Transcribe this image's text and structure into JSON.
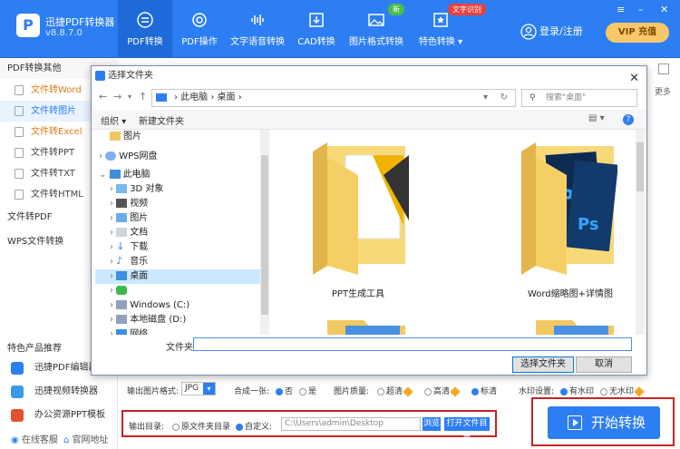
{
  "app": {
    "name": "迅捷PDF转换器",
    "version": "v8.8.7.0",
    "logo_letter": "P"
  },
  "nav": [
    {
      "label": "PDF转换",
      "icon": "pdf-convert-icon",
      "active": true
    },
    {
      "label": "PDF操作",
      "icon": "gear-icon"
    },
    {
      "label": "文字语音转换",
      "icon": "waveform-icon"
    },
    {
      "label": "CAD转换",
      "icon": "download-box-icon"
    },
    {
      "label": "图片格式转换",
      "icon": "image-icon",
      "badge": "新"
    },
    {
      "label": "特色转换",
      "icon": "star-box-icon",
      "badge": "文字识别"
    }
  ],
  "header": {
    "login": "登录/注册",
    "vip": "VIP 充值"
  },
  "sidebar": {
    "group_pdf": "PDF转换其他",
    "items": [
      {
        "label": "文件转Word"
      },
      {
        "label": "文件转图片"
      },
      {
        "label": "文件转Excel"
      },
      {
        "label": "文件转PPT"
      },
      {
        "label": "文件转TXT"
      },
      {
        "label": "文件转HTML"
      }
    ],
    "group_to_pdf": "文件转PDF",
    "group_wps": "WPS文件转换",
    "featured_title": "特色产品推荐",
    "products": [
      {
        "label": "迅捷PDF编辑器"
      },
      {
        "label": "迅捷视频转换器"
      },
      {
        "label": "办公资源PPT模板"
      }
    ],
    "footer": {
      "support": "在线客服",
      "website": "官网地址"
    }
  },
  "right_panel": {
    "more": "更多"
  },
  "dialog": {
    "title": "选择文件夹",
    "breadcrumb": [
      "此电脑",
      "桌面"
    ],
    "search_placeholder": "搜索\"桌面\"",
    "commands": {
      "organize": "组织 ▾",
      "new_folder": "新建文件夹"
    },
    "tree": [
      {
        "label": "图片",
        "icon": "folder-icon"
      },
      {
        "label": "WPS网盘",
        "icon": "cloud-icon"
      },
      {
        "label": "此电脑",
        "icon": "computer-icon"
      },
      {
        "label": "3D 对象",
        "icon": "cube-icon"
      },
      {
        "label": "视频",
        "icon": "video-icon"
      },
      {
        "label": "图片",
        "icon": "image-icon"
      },
      {
        "label": "文档",
        "icon": "document-icon"
      },
      {
        "label": "下载",
        "icon": "download-icon"
      },
      {
        "label": "音乐",
        "icon": "music-icon"
      },
      {
        "label": "桌面",
        "icon": "desktop-icon"
      },
      {
        "label": "",
        "icon": "wechat-icon"
      },
      {
        "label": "Windows (C:)",
        "icon": "drive-icon"
      },
      {
        "label": "本地磁盘 (D:)",
        "icon": "drive-icon"
      },
      {
        "label": "网络",
        "icon": "network-icon"
      }
    ],
    "folders": [
      {
        "label": "PPT生成工具"
      },
      {
        "label": "Word缩略图+详情图"
      }
    ],
    "filename_label": "文件夹:",
    "filename_value": "",
    "buttons": {
      "select": "选择文件夹",
      "cancel": "取消"
    }
  },
  "options": {
    "format_label": "输出图片格式:",
    "format_value": "JPG",
    "merge_label": "合成一张:",
    "merge_no": "否",
    "merge_yes": "是",
    "quality_label": "图片质量:",
    "quality_high": "超清",
    "quality_hd": "高清",
    "quality_std": "标清",
    "watermark_label": "水印设置:",
    "watermark_on": "有水印",
    "watermark_off": "无水印"
  },
  "output": {
    "label": "输出目录:",
    "orig": "原文件夹目录",
    "custom": "自定义:",
    "path": "C:\\Users\\admin\\Desktop",
    "browse": "浏览",
    "open": "打开文件目录"
  },
  "start": {
    "label": "开始转换"
  },
  "colors": {
    "brand": "#2d7ef2",
    "highlight": "#c42323",
    "accent": "#e07a14"
  }
}
